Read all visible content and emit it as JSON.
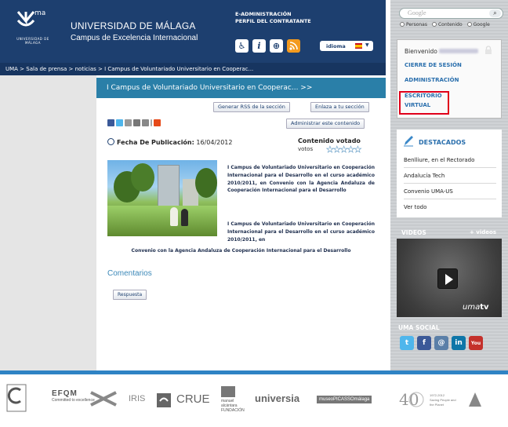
{
  "header": {
    "logo_text_top": "ma",
    "logo_text_bottom": "UNIVERSIDAD DE MÁLAGA",
    "university": "UNIVERSIDAD DE MÁLAGA",
    "campus": "Campus de Excelencia Internacional",
    "top_links": [
      "E-ADMINISTRACIÓN",
      "PERFIL DEL CONTRATANTE"
    ],
    "idioma_label": "idioma",
    "access_icons": [
      "accessibility-icon",
      "info-icon",
      "web-icon",
      "rss-icon"
    ]
  },
  "breadcrumb": {
    "items": [
      "UMA",
      "Sala de prensa",
      "noticias",
      "I Campus de Voluntariado Universitario en Cooperac..."
    ],
    "separator": " > "
  },
  "article": {
    "title": "I Campus de Voluntariado Universitario en Cooperac... >>",
    "rss_button": "Generar RSS de la sección",
    "link_button": "Enlaza a tu sección",
    "admin_button": "Administrar este contenido",
    "pub_label": "Fecha De Publicación:",
    "pub_date": "16/04/2012",
    "voted_label": "Contenido votado",
    "votes_label": "votos",
    "stars": 5,
    "paragraph1": "I Campus de Voluntariado Universitario en Cooperación Internacional para el Desarrollo en el curso académico 2010/2011, en Convenio con la Agencia Andaluza de Cooperación Internacional para el Desarrollo",
    "paragraph2a": "I Campus de Voluntariado Universitario en Cooperación Internacional para el Desarrollo en el curso académico 2010/2011, en",
    "paragraph2b": "Convenio con la Agencia Andaluza de Cooperación Internacional para el Desarrollo",
    "comments_title": "Comentarios",
    "reply_button": "Respuesta"
  },
  "sidebar": {
    "search_placeholder": "Google",
    "search_options": [
      "Personas",
      "Contenido",
      "Google"
    ],
    "welcome": "Bienvenido",
    "links": [
      "CIERRE DE SESIÓN",
      "ADMINISTRACIÓN",
      "ESCRITORIO",
      "VIRTUAL"
    ],
    "destacados_title": "DESTACADOS",
    "destacados": [
      "Benlliure, en el Rectorado",
      "Andalucía Tech",
      "Convenio UMA-US",
      "Ver todo"
    ],
    "videos_title": "VIDEOS",
    "more_videos": "+ videos",
    "umatv_a": "uma",
    "umatv_b": "tv",
    "social_title": "UMA SOCIAL",
    "social_icons": [
      "twitter-icon",
      "facebook-icon",
      "email-icon",
      "linkedin-icon",
      "youtube-icon"
    ]
  },
  "footer": {
    "logos": [
      "EFQM",
      "Committed to excellence",
      "IRIS",
      "CRUE",
      "manuel alcántara FUNDACIÓN",
      "universia",
      "museoPICASSOmálaga",
      "1972-2012",
      "Saving People and the Planet"
    ]
  },
  "colors": {
    "header_bg": "#1d3f6f",
    "title_bar": "#2a7fa8",
    "link_blue": "#2a6fad",
    "highlight": "#e0001a",
    "footer_bar": "#2f83c4"
  }
}
